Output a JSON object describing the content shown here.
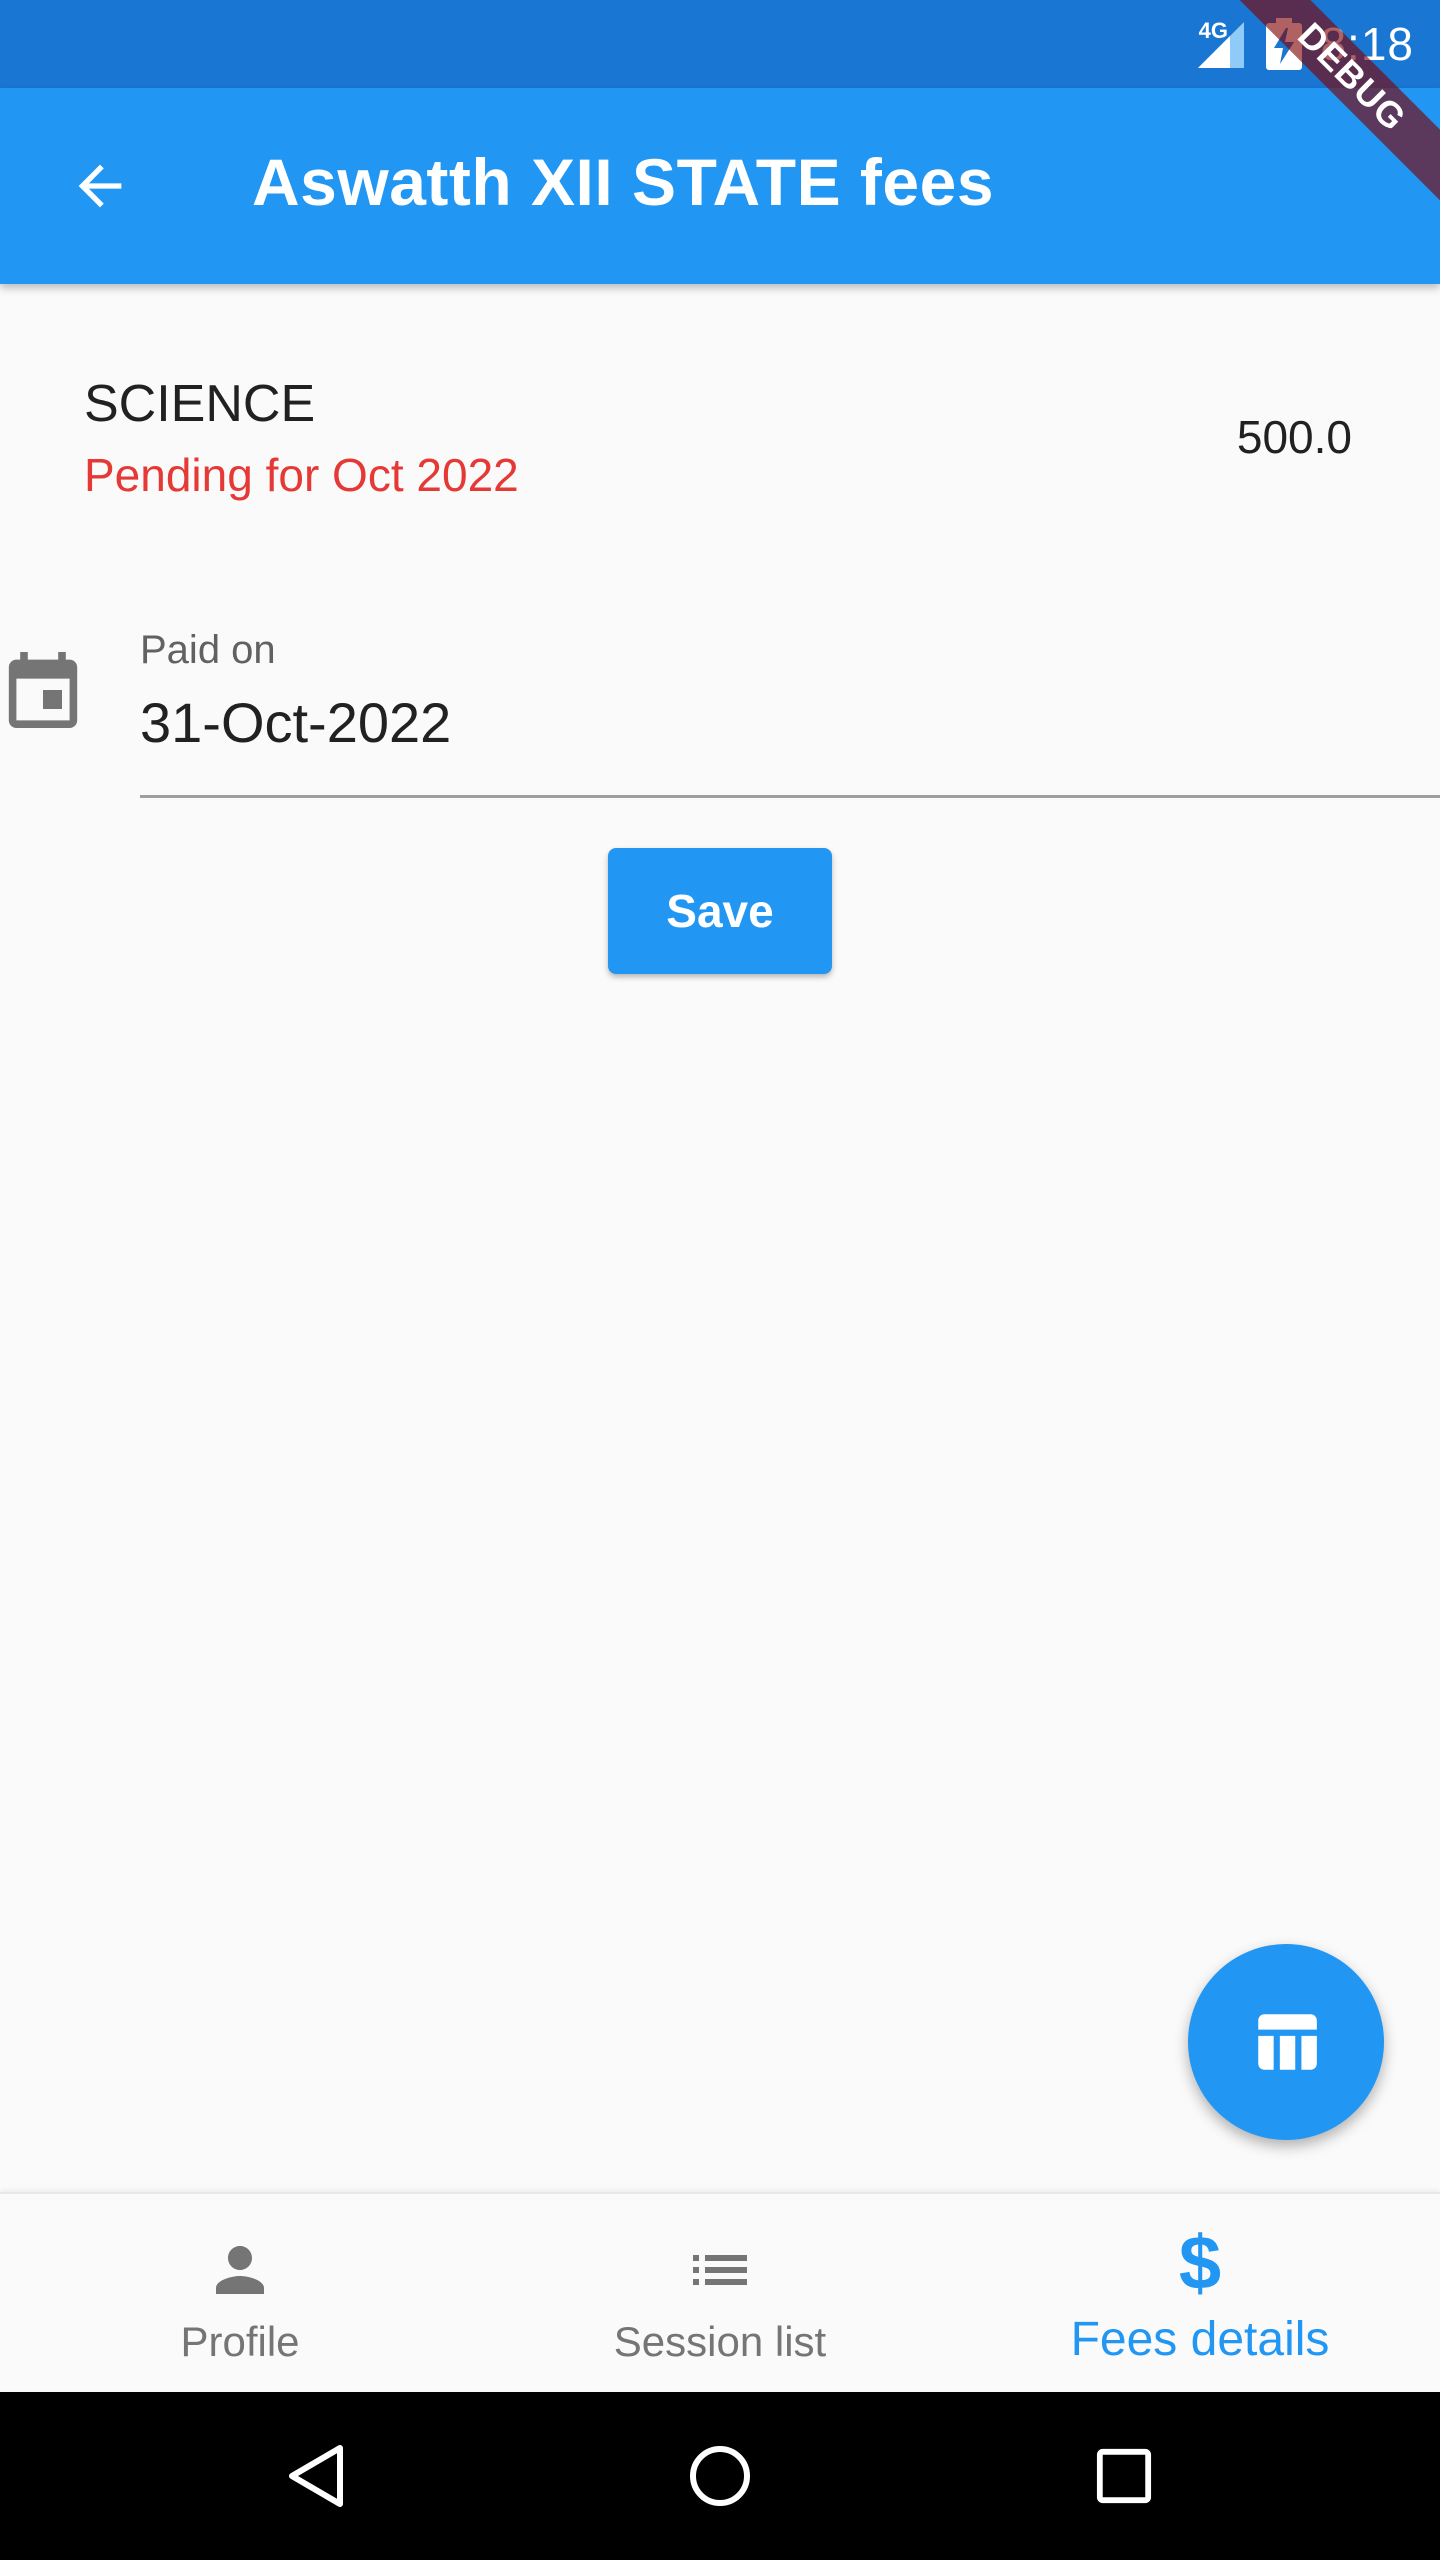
{
  "status_bar": {
    "network": "4G",
    "time": "8:18"
  },
  "debug_banner": "DEBUG",
  "app_bar": {
    "title": "Aswatth XII STATE fees"
  },
  "fee": {
    "subject": "SCIENCE",
    "status": "Pending for Oct 2022",
    "amount": "500.0"
  },
  "date_field": {
    "label": "Paid on",
    "value": "31-Oct-2022"
  },
  "actions": {
    "save_label": "Save"
  },
  "bottom_nav": {
    "items": [
      {
        "label": "Profile",
        "icon": "person-icon",
        "active": false
      },
      {
        "label": "Session list",
        "icon": "list-icon",
        "active": false
      },
      {
        "label": "Fees details",
        "icon": "dollar-icon",
        "active": true
      }
    ]
  },
  "colors": {
    "primary": "#2196f3",
    "status_bar": "#1976d2",
    "pending": "#e53935"
  }
}
